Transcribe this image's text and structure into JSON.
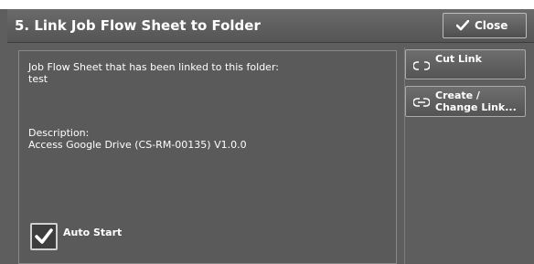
{
  "header": {
    "title": "5. Link Job Flow Sheet to Folder",
    "close_label": "Close"
  },
  "panel": {
    "linked_label": "Job Flow Sheet that has been linked to this folder:",
    "linked_value": "test",
    "description_label": "Description:",
    "description_value": "Access Google Drive (CS-RM-00135) V1.0.0",
    "auto_start_label": "Auto Start",
    "auto_start_checked": true
  },
  "actions": {
    "cut_link_label": "Cut Link",
    "create_link_line1": "Create /",
    "create_link_line2": "Change Link..."
  },
  "icons": [
    "checkmark-icon",
    "cut-link-icon",
    "link-icon"
  ]
}
